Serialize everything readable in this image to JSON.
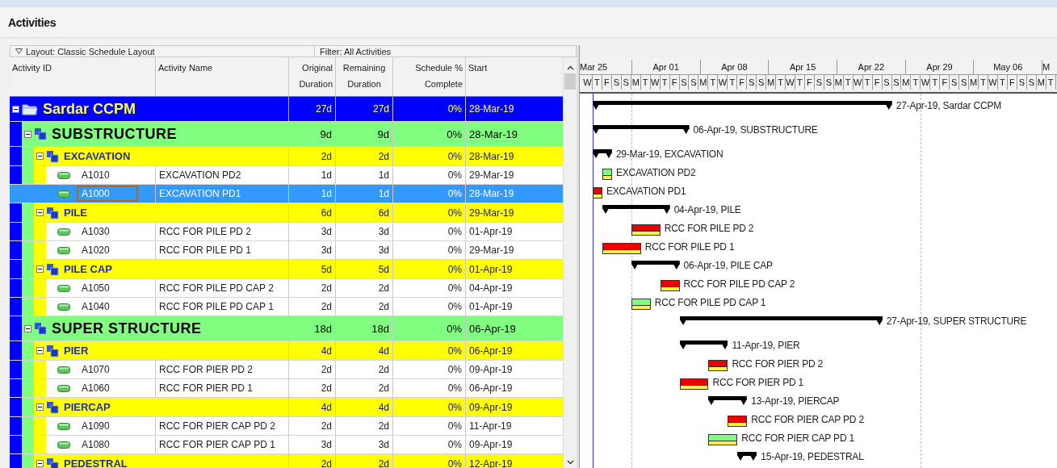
{
  "title": "Activities",
  "layout": {
    "label": "Layout: Classic Schedule Layout"
  },
  "filter": {
    "label": "Filter: All Activities"
  },
  "columns": [
    "Activity ID",
    "Activity Name",
    "Original Duration",
    "Remaining Duration",
    "Schedule % Complete",
    "Start"
  ],
  "timescale": {
    "weeks": [
      "Mar 25",
      "Apr 01",
      "Apr 08",
      "Apr 15",
      "Apr 22",
      "Apr 29",
      "May 06",
      "M"
    ],
    "days": [
      "W",
      "T",
      "F",
      "S",
      "S",
      "M",
      "T",
      "W",
      "T",
      "F",
      "S",
      "S",
      "M",
      "T",
      "W",
      "T",
      "F",
      "S",
      "S",
      "M",
      "T",
      "W",
      "T",
      "F",
      "S",
      "S",
      "M",
      "T",
      "W",
      "T",
      "F",
      "S",
      "S",
      "M",
      "T",
      "W",
      "T",
      "F",
      "S",
      "S",
      "M",
      "T",
      "W",
      "T",
      "F",
      "S",
      "S",
      "M",
      "T"
    ]
  },
  "rows": [
    {
      "kind": "project",
      "name": "Sardar CCPM",
      "expanded": true,
      "selected": false,
      "original": "27d",
      "remaining": "27d",
      "percent": "0%",
      "start": "28-Mar-19",
      "bar_label": "27-Apr-19, Sardar CCPM",
      "children": [
        {
          "kind": "wbs",
          "name": "SUBSTRUCTURE",
          "expanded": true,
          "selected": false,
          "original": "9d",
          "remaining": "9d",
          "percent": "0%",
          "start": "28-Mar-19",
          "bar_label": "06-Apr-19, SUBSTRUCTURE",
          "children": [
            {
              "kind": "wbs",
              "name": "EXCAVATION",
              "expanded": true,
              "selected": false,
              "original": "2d",
              "remaining": "2d",
              "percent": "0%",
              "start": "28-Mar-19",
              "bar_label": "29-Mar-19, EXCAVATION",
              "children": [
                {
                  "kind": "activity",
                  "id": "A1010",
                  "name": "EXCAVATION PD2",
                  "critical": false,
                  "selected": false,
                  "original": "1d",
                  "remaining": "1d",
                  "percent": "0%",
                  "start": "29-Mar-19",
                  "bar_label": "EXCAVATION PD2"
                },
                {
                  "kind": "activity",
                  "id": "A1000",
                  "name": "EXCAVATION PD1",
                  "critical": true,
                  "selected": true,
                  "original": "1d",
                  "remaining": "1d",
                  "percent": "0%",
                  "start": "28-Mar-19",
                  "bar_label": "EXCAVATION PD1"
                }
              ]
            },
            {
              "kind": "wbs",
              "name": "PILE",
              "expanded": true,
              "selected": false,
              "original": "6d",
              "remaining": "6d",
              "percent": "0%",
              "start": "29-Mar-19",
              "bar_label": "04-Apr-19, PILE",
              "children": [
                {
                  "kind": "activity",
                  "id": "A1030",
                  "name": "RCC FOR PILE PD 2",
                  "critical": true,
                  "selected": false,
                  "original": "3d",
                  "remaining": "3d",
                  "percent": "0%",
                  "start": "01-Apr-19",
                  "bar_label": "RCC FOR PILE PD 2"
                },
                {
                  "kind": "activity",
                  "id": "A1020",
                  "name": "RCC FOR PILE PD 1",
                  "critical": true,
                  "selected": false,
                  "original": "3d",
                  "remaining": "3d",
                  "percent": "0%",
                  "start": "29-Mar-19",
                  "bar_label": "RCC FOR PILE PD 1"
                }
              ]
            },
            {
              "kind": "wbs",
              "name": "PILE CAP",
              "expanded": true,
              "selected": false,
              "original": "5d",
              "remaining": "5d",
              "percent": "0%",
              "start": "01-Apr-19",
              "bar_label": "06-Apr-19, PILE CAP",
              "children": [
                {
                  "kind": "activity",
                  "id": "A1050",
                  "name": "RCC FOR PILE PD CAP 2",
                  "critical": true,
                  "selected": false,
                  "original": "2d",
                  "remaining": "2d",
                  "percent": "0%",
                  "start": "04-Apr-19",
                  "bar_label": "RCC FOR PILE PD CAP 2"
                },
                {
                  "kind": "activity",
                  "id": "A1040",
                  "name": "RCC FOR PILE PD CAP 1",
                  "critical": false,
                  "selected": false,
                  "original": "2d",
                  "remaining": "2d",
                  "percent": "0%",
                  "start": "01-Apr-19",
                  "bar_label": "RCC FOR PILE PD CAP 1"
                }
              ]
            }
          ]
        },
        {
          "kind": "wbs",
          "name": "SUPER STRUCTURE",
          "expanded": true,
          "selected": false,
          "original": "18d",
          "remaining": "18d",
          "percent": "0%",
          "start": "06-Apr-19",
          "bar_label": "27-Apr-19, SUPER STRUCTURE",
          "children": [
            {
              "kind": "wbs",
              "name": "PIER",
              "expanded": true,
              "selected": false,
              "original": "4d",
              "remaining": "4d",
              "percent": "0%",
              "start": "06-Apr-19",
              "bar_label": "11-Apr-19, PIER",
              "children": [
                {
                  "kind": "activity",
                  "id": "A1070",
                  "name": "RCC FOR PIER PD 2",
                  "critical": true,
                  "selected": false,
                  "original": "2d",
                  "remaining": "2d",
                  "percent": "0%",
                  "start": "09-Apr-19",
                  "bar_label": "RCC FOR PIER PD 2"
                },
                {
                  "kind": "activity",
                  "id": "A1060",
                  "name": "RCC FOR PIER PD 1",
                  "critical": true,
                  "selected": false,
                  "original": "2d",
                  "remaining": "2d",
                  "percent": "0%",
                  "start": "06-Apr-19",
                  "bar_label": "RCC FOR PIER PD 1"
                }
              ]
            },
            {
              "kind": "wbs",
              "name": "PIERCAP",
              "expanded": true,
              "selected": false,
              "original": "4d",
              "remaining": "4d",
              "percent": "0%",
              "start": "09-Apr-19",
              "bar_label": "13-Apr-19, PIERCAP",
              "children": [
                {
                  "kind": "activity",
                  "id": "A1090",
                  "name": "RCC FOR PIER CAP PD 2",
                  "critical": true,
                  "selected": false,
                  "original": "2d",
                  "remaining": "2d",
                  "percent": "0%",
                  "start": "11-Apr-19",
                  "bar_label": "RCC FOR PIER CAP PD 2"
                },
                {
                  "kind": "activity",
                  "id": "A1080",
                  "name": "RCC FOR PIER CAP PD 1",
                  "critical": false,
                  "selected": false,
                  "original": "3d",
                  "remaining": "3d",
                  "percent": "0%",
                  "start": "09-Apr-19",
                  "bar_label": "RCC FOR PIER CAP PD 1"
                }
              ]
            },
            {
              "kind": "wbs",
              "name": "PEDESTRAL",
              "expanded": true,
              "selected": false,
              "original": "2d",
              "remaining": "2d",
              "percent": "0%",
              "start": "12-Apr-19",
              "bar_label": "15-Apr-19, PEDESTRAL"
            }
          ]
        }
      ]
    }
  ]
}
